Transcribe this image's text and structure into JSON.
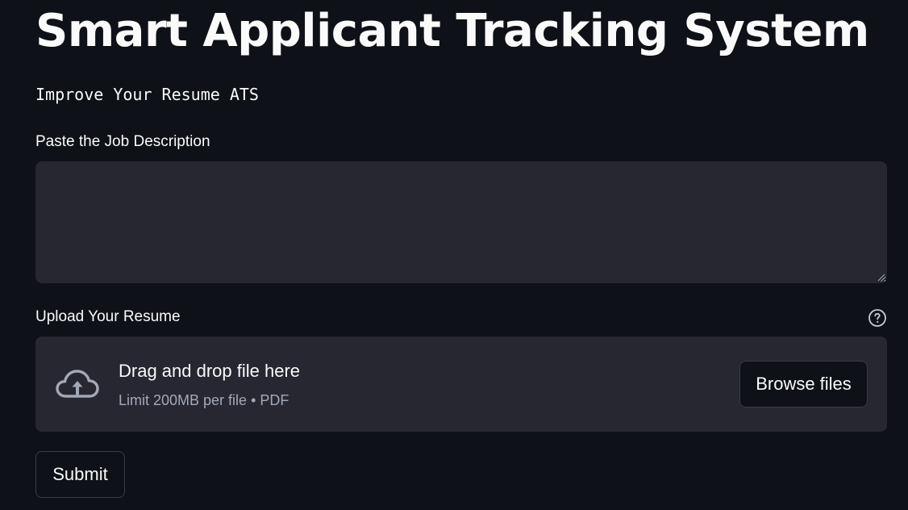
{
  "header": {
    "title": "Smart Applicant Tracking System",
    "subtitle": "Improve Your Resume ATS"
  },
  "job_description": {
    "label": "Paste the Job Description",
    "value": "",
    "placeholder": ""
  },
  "resume_upload": {
    "label": "Upload Your Resume",
    "help_icon": "question-circle-icon",
    "dropzone_icon": "cloud-upload-icon",
    "dropzone_title": "Drag and drop file here",
    "dropzone_limit": "Limit 200MB per file • PDF",
    "browse_label": "Browse files"
  },
  "actions": {
    "submit_label": "Submit"
  },
  "colors": {
    "background": "#0e1117",
    "surface": "#262730",
    "text": "#fafafa",
    "muted_text": "#a3a8b8",
    "border": "#3a3c46"
  }
}
